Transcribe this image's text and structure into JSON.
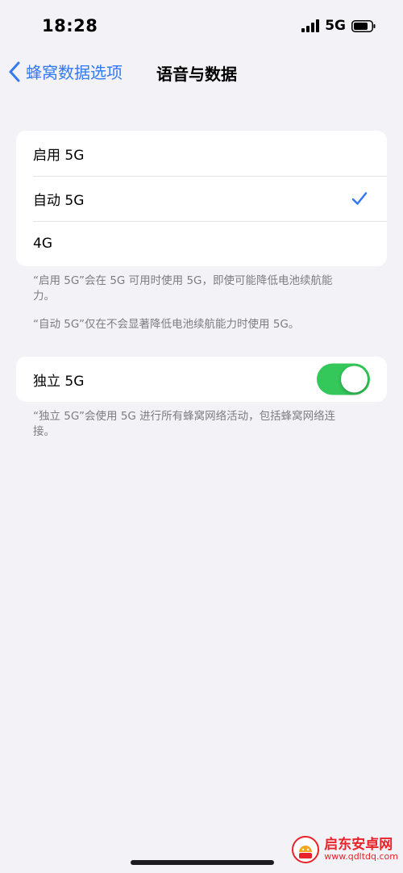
{
  "status_bar": {
    "time": "18:28",
    "network": "5G"
  },
  "nav": {
    "back_label": "蜂窝数据选项",
    "title": "语音与数据"
  },
  "voice_data_group": {
    "items": [
      {
        "label": "启用 5G",
        "selected": false
      },
      {
        "label": "自动 5G",
        "selected": true
      },
      {
        "label": "4G",
        "selected": false
      }
    ],
    "footnote_1": "“启用 5G”会在 5G 可用时使用 5G，即使可能降低电池续航能力。",
    "footnote_2": "“自动 5G”仅在不会显著降低电池续航能力时使用 5G。"
  },
  "standalone_group": {
    "label": "独立 5G",
    "enabled": true,
    "footnote": "“独立 5G”会使用 5G 进行所有蜂窝网络活动，包括蜂窝网络连接。"
  },
  "watermark": {
    "name": "启东安卓网",
    "url": "www.qdltdq.com"
  },
  "colors": {
    "accent": "#3478f6",
    "toggle_on": "#34c759",
    "background": "#f2f2f7",
    "watermark": "#e8232a"
  }
}
